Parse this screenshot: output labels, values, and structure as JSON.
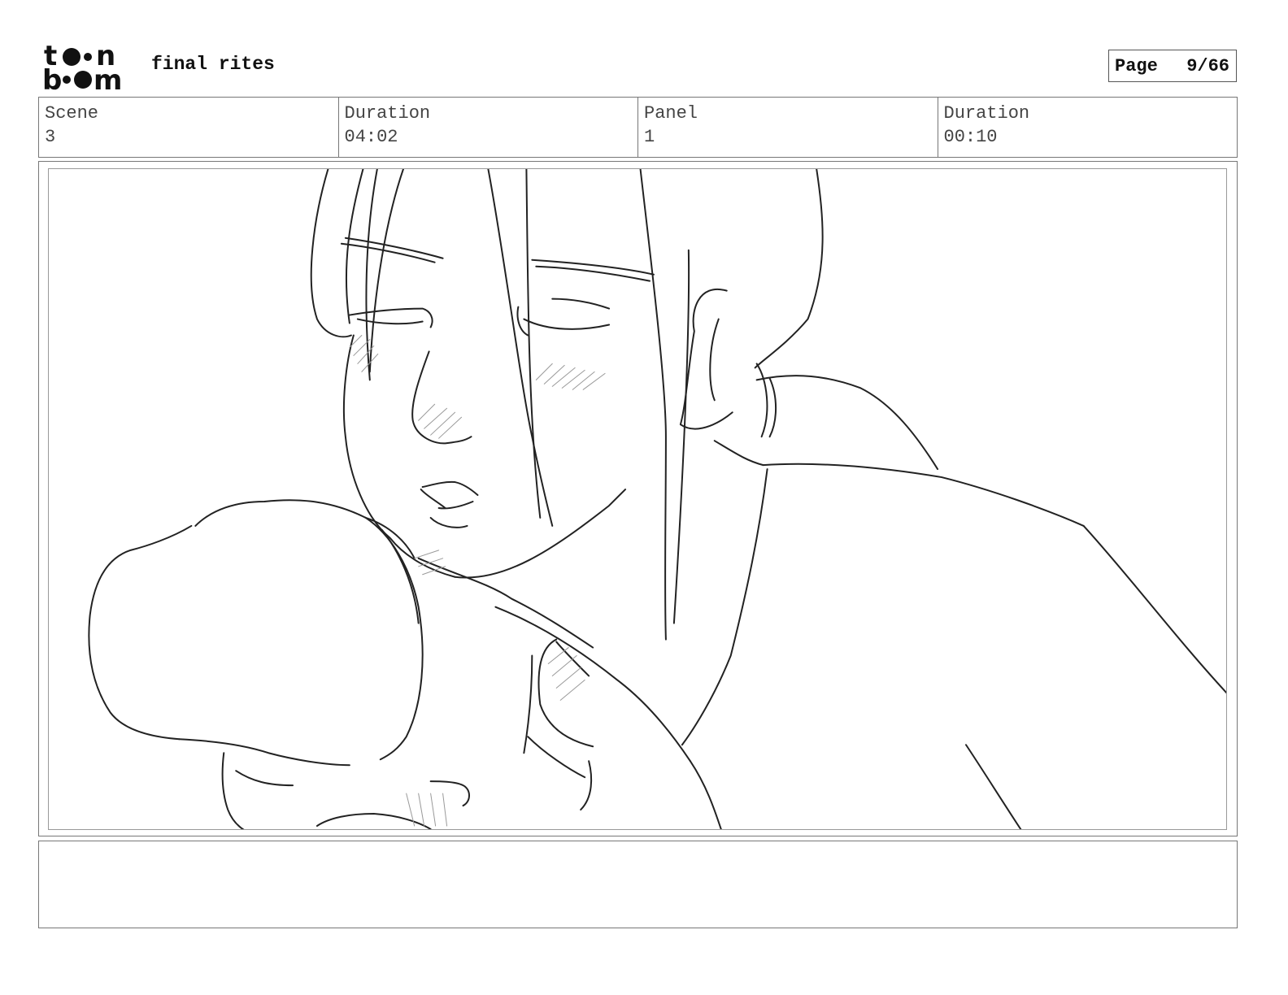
{
  "header": {
    "logo_text": "toon boom",
    "project_title": "final rites",
    "page_label": "Page",
    "page_value": "9/66"
  },
  "info": {
    "scene_label": "Scene",
    "scene_value": "3",
    "scene_duration_label": "Duration",
    "scene_duration_value": "04:02",
    "panel_label": "Panel",
    "panel_value": "1",
    "panel_duration_label": "Duration",
    "panel_duration_value": "00:10"
  },
  "panel": {
    "image": "storyboard-sketch-woman-embrace"
  },
  "caption": {
    "text": ""
  }
}
